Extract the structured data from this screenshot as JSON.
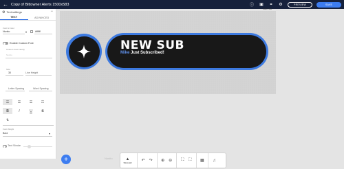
{
  "topbar": {
    "title": "Copy of Bittowner Alerts 1500x583",
    "preview_label": "PREVIEW",
    "save_label": "SAVE"
  },
  "panel": {
    "header": "Text settings",
    "tabs": [
      "TEXT",
      "ADVANCED"
    ],
    "font_label": "Font & Color",
    "font_value": "Nunito",
    "color_value": "#ffffff",
    "custom_font_label": "Enable Custom Font",
    "custom_font_sub": "Custom Font Family",
    "custom_font_placeholder": "Nunito",
    "size_label": "Size",
    "size_value": "30",
    "line_height_label": "Line Height",
    "letter_spacing_label": "Letter Spacing",
    "word_spacing_label": "Word Spacing",
    "style_buttons": [
      "B",
      "I",
      "U",
      "S"
    ],
    "font_weight_label": "Font Weight",
    "font_weight_value": "Bold",
    "text_stroke_label": "Text Stroke"
  },
  "canvas": {
    "size_label": "1500 x 583",
    "alert_title": "NEW SUB",
    "alert_name": "Mike",
    "alert_message": " Just Subscribed!"
  },
  "toolbar": {
    "smaller_label": "SMALLER"
  },
  "colors": {
    "topbar": "#16213b",
    "accent": "#3d7df0",
    "alert_blue": "#3d7ae0"
  }
}
